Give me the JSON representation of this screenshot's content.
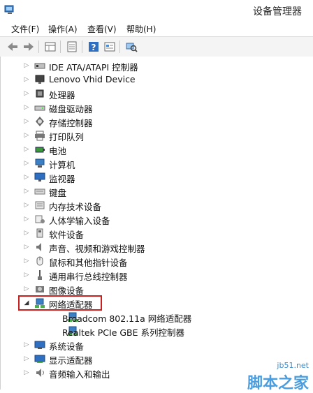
{
  "window": {
    "title": "设备管理器"
  },
  "menu": [
    {
      "label": "文件(F)"
    },
    {
      "label": "操作(A)"
    },
    {
      "label": "查看(V)"
    },
    {
      "label": "帮助(H)"
    }
  ],
  "toolbar": {
    "buttons": [
      "back-icon",
      "forward-icon",
      "properties-grid-icon",
      "device-list-icon",
      "help-icon",
      "details-icon",
      "scan-hardware-icon"
    ]
  },
  "tree": [
    {
      "label": "IDE ATA/ATAPI 控制器",
      "icon": "ide-controller-icon",
      "expanded": false,
      "level": 0
    },
    {
      "label": "Lenovo Vhid Device",
      "icon": "monitor-device-icon",
      "expanded": false,
      "level": 0
    },
    {
      "label": "处理器",
      "icon": "processor-icon",
      "expanded": false,
      "level": 0
    },
    {
      "label": "磁盘驱动器",
      "icon": "disk-drive-icon",
      "expanded": false,
      "level": 0
    },
    {
      "label": "存储控制器",
      "icon": "storage-controller-icon",
      "expanded": false,
      "level": 0
    },
    {
      "label": "打印队列",
      "icon": "printer-icon",
      "expanded": false,
      "level": 0
    },
    {
      "label": "电池",
      "icon": "battery-icon",
      "expanded": false,
      "level": 0
    },
    {
      "label": "计算机",
      "icon": "computer-icon",
      "expanded": false,
      "level": 0
    },
    {
      "label": "监视器",
      "icon": "monitor-icon",
      "expanded": false,
      "level": 0
    },
    {
      "label": "键盘",
      "icon": "keyboard-icon",
      "expanded": false,
      "level": 0
    },
    {
      "label": "内存技术设备",
      "icon": "memory-device-icon",
      "expanded": false,
      "level": 0
    },
    {
      "label": "人体学输入设备",
      "icon": "hid-icon",
      "expanded": false,
      "level": 0
    },
    {
      "label": "软件设备",
      "icon": "software-device-icon",
      "expanded": false,
      "level": 0
    },
    {
      "label": "声音、视频和游戏控制器",
      "icon": "speaker-icon",
      "expanded": false,
      "level": 0
    },
    {
      "label": "鼠标和其他指针设备",
      "icon": "mouse-icon",
      "expanded": false,
      "level": 0
    },
    {
      "label": "通用串行总线控制器",
      "icon": "usb-icon",
      "expanded": false,
      "level": 0
    },
    {
      "label": "图像设备",
      "icon": "camera-icon",
      "expanded": false,
      "level": 0
    },
    {
      "label": "网络适配器",
      "icon": "network-adapter-icon",
      "expanded": true,
      "level": 0,
      "highlighted": true
    },
    {
      "label": "Broadcom 802.11a 网络适配器",
      "icon": "network-adapter-icon",
      "level": 1
    },
    {
      "label": "Realtek PCIe GBE 系列控制器",
      "icon": "network-adapter-icon",
      "level": 1
    },
    {
      "label": "系统设备",
      "icon": "system-device-icon",
      "expanded": false,
      "level": 0
    },
    {
      "label": "显示适配器",
      "icon": "display-adapter-icon",
      "expanded": false,
      "level": 0
    },
    {
      "label": "音频输入和输出",
      "icon": "audio-io-icon",
      "expanded": false,
      "level": 0
    }
  ],
  "watermark": {
    "line1": "jb51.net",
    "line2": "脚本之家"
  }
}
